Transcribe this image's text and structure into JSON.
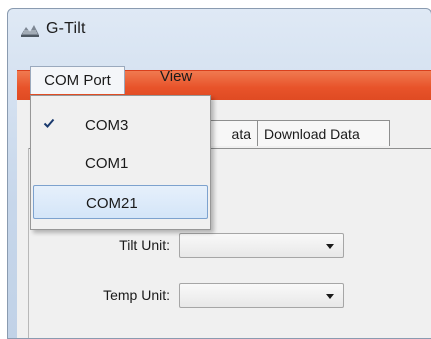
{
  "window": {
    "title": "G-Tilt",
    "accent_color": "#e8532a"
  },
  "menubar": {
    "items": [
      {
        "label": "COM Port",
        "open": true
      },
      {
        "label": "View",
        "open": false
      }
    ]
  },
  "com_port_menu": {
    "items": [
      {
        "label": "COM3",
        "checked": true,
        "highlighted": false
      },
      {
        "label": "COM1",
        "checked": false,
        "highlighted": false
      },
      {
        "label": "COM21",
        "checked": false,
        "highlighted": true
      }
    ]
  },
  "tabs": [
    {
      "label": "ata",
      "partially_hidden": true
    },
    {
      "label": "Download Data"
    }
  ],
  "form": {
    "tilt_unit": {
      "label": "Tilt Unit:",
      "value": ""
    },
    "temp_unit": {
      "label": "Temp Unit:",
      "value": ""
    }
  },
  "icons": {
    "app": "g-tilt-app-icon",
    "check": "check-icon",
    "dropdown_arrow": "chevron-down-icon"
  }
}
